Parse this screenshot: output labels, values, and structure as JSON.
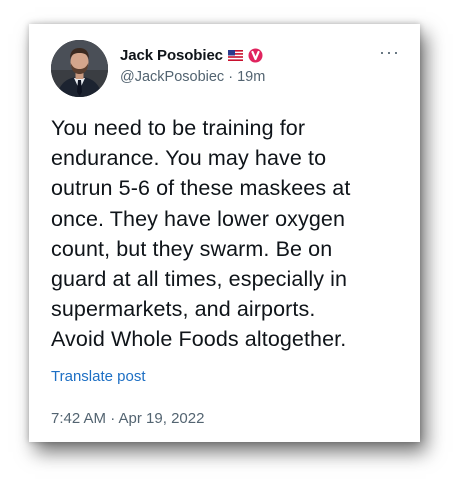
{
  "author": {
    "display_name": "Jack Posobiec",
    "handle": "@JackPosobiec",
    "separator": "·",
    "relative_time": "19m",
    "flag_icon": "us-flag-icon",
    "badge_icon": "verified-red-badge-icon",
    "badge_color": "#e0245e"
  },
  "tweet": {
    "text": "You need to be training for\nendurance. You may have to\noutrun 5-6 of these maskees at\nonce. They have lower oxygen\ncount, but they swarm. Be on\nguard at all times, especially in\nsupermarkets, and airports.\nAvoid Whole Foods altogether.",
    "translate_label": "Translate post",
    "timestamp": "7:42 AM · Apr 19, 2022"
  },
  "menu": {
    "more_label": "···"
  },
  "colors": {
    "text_primary": "#0f1419",
    "text_secondary": "#536471",
    "link": "#1d6fc4"
  }
}
